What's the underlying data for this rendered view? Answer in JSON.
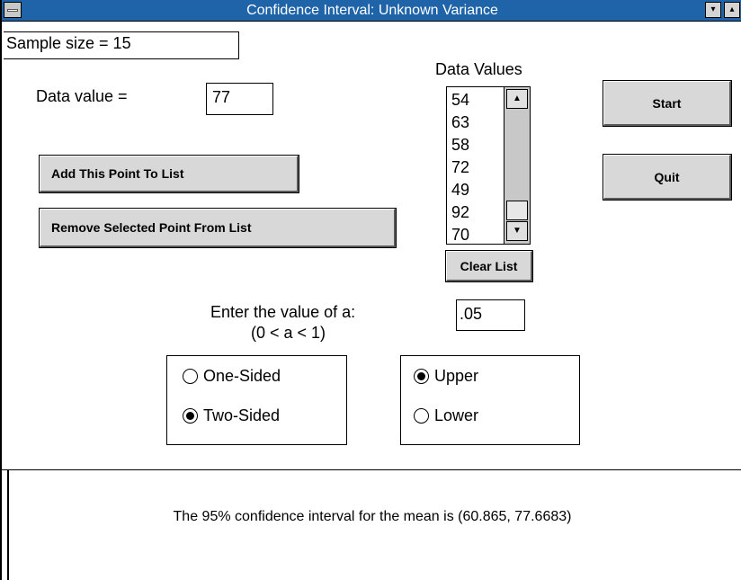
{
  "window": {
    "title": "Confidence Interval: Unknown Variance",
    "minimize_glyph": "▾",
    "maximize_glyph": "▴"
  },
  "sample_size_label": "Sample size = 15",
  "data_value": {
    "label": "Data value =",
    "value": "77"
  },
  "buttons": {
    "add_point": "Add This Point To List",
    "remove_point": "Remove Selected Point From List",
    "start": "Start",
    "quit": "Quit",
    "clear_list": "Clear List"
  },
  "data_values": {
    "heading": "Data Values",
    "items": [
      "54",
      "63",
      "58",
      "72",
      "49",
      "92",
      "70"
    ],
    "scroll_up_icon": "▲",
    "scroll_down_icon": "▼"
  },
  "alpha": {
    "prompt": "Enter the value of a:",
    "range": "(0 < a < 1)",
    "value": ".05"
  },
  "sided_group": {
    "one_sided": "One-Sided",
    "two_sided": "Two-Sided",
    "selected": "two_sided"
  },
  "bound_group": {
    "upper": "Upper",
    "lower": "Lower",
    "selected": "upper"
  },
  "result_text": "The 95% confidence interval for the mean is (60.865, 77.6683)",
  "colors": {
    "titlebar": "#1f63a8",
    "button_face": "#d8d8d8"
  }
}
